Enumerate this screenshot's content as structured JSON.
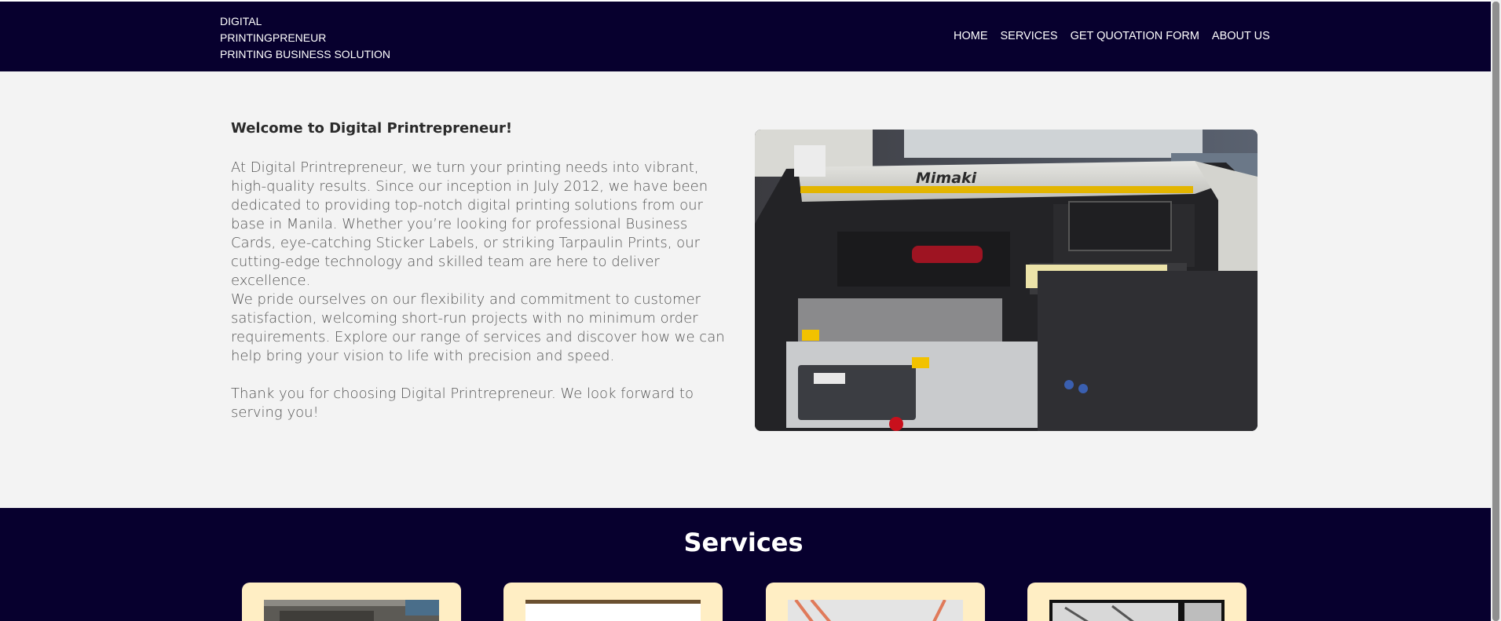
{
  "header": {
    "brand_lines": [
      "DIGITAL",
      "PRINTINGPRENEUR",
      "PRINTING BUSINESS SOLUTION"
    ],
    "nav": [
      "HOME",
      "SERVICES",
      "GET QUOTATION FORM",
      "ABOUT US"
    ]
  },
  "intro": {
    "welcome": "Welcome to Digital Printrepreneur!",
    "paragraphs": [
      "At Digital Printrepreneur, we turn your printing needs into vibrant, high-quality results. Since our inception in July 2012, we have been dedicated to providing top-notch digital printing solutions from our base in Manila. Whether you’re looking for professional Business Cards, eye-catching Sticker Labels, or striking Tarpaulin Prints, our cutting-edge technology and skilled team are here to deliver excellence.",
      "We pride ourselves on our flexibility and commitment to customer satisfaction, welcoming short-run projects with no minimum order requirements. Explore our range of services and discover how we can help bring your vision to life with precision and speed.",
      "Thank you for choosing Digital Printrepreneur. We look forward to serving you!"
    ],
    "image_brand": "Mimaki"
  },
  "services": {
    "title": "Services"
  },
  "colors": {
    "navy": "#07002e",
    "card": "#ffeec4",
    "page_bg": "#f3f3f3"
  }
}
